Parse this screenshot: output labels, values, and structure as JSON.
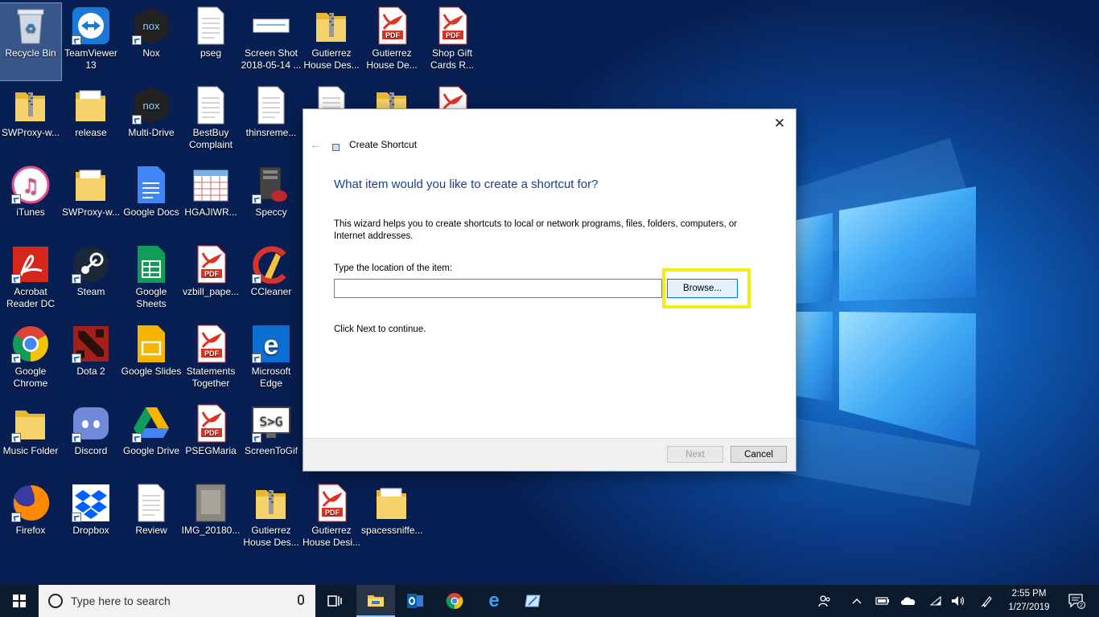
{
  "desktop": {
    "icons": [
      {
        "label": "Recycle Bin",
        "kind": "recycle",
        "shortcut": false,
        "selected": true
      },
      {
        "label": "TeamViewer 13",
        "kind": "teamviewer",
        "shortcut": true
      },
      {
        "label": "Nox",
        "kind": "nox",
        "shortcut": true
      },
      {
        "label": "pseg",
        "kind": "doc",
        "shortcut": false
      },
      {
        "label": "Screen Shot 2018-05-14 ...",
        "kind": "screenshot",
        "shortcut": false
      },
      {
        "label": "Gutierrez House Des...",
        "kind": "zipfolder",
        "shortcut": false
      },
      {
        "label": "Gutierrez House De...",
        "kind": "pdf",
        "shortcut": false
      },
      {
        "label": "Shop Gift Cards R...",
        "kind": "pdf",
        "shortcut": false
      },
      {
        "label": "SWProxy-w...",
        "kind": "zipfolder",
        "shortcut": false
      },
      {
        "label": "release",
        "kind": "folder",
        "shortcut": false
      },
      {
        "label": "Multi-Drive",
        "kind": "nox",
        "shortcut": true
      },
      {
        "label": "BestBuy Complaint",
        "kind": "doc",
        "shortcut": false
      },
      {
        "label": "thinsreme...",
        "kind": "doc",
        "shortcut": false
      },
      {
        "label": "",
        "kind": "doc",
        "shortcut": false
      },
      {
        "label": "",
        "kind": "zipfolder",
        "shortcut": false
      },
      {
        "label": "",
        "kind": "pdf",
        "shortcut": false
      },
      {
        "label": "iTunes",
        "kind": "itunes",
        "shortcut": true
      },
      {
        "label": "SWProxy-w...",
        "kind": "folder",
        "shortcut": false
      },
      {
        "label": "Google Docs",
        "kind": "gdocs",
        "shortcut": false
      },
      {
        "label": "HGAJIWR...",
        "kind": "calendar",
        "shortcut": false
      },
      {
        "label": "Speccy",
        "kind": "speccy",
        "shortcut": true
      },
      {
        "label": "Acrobat Reader DC",
        "kind": "acrobat",
        "shortcut": true
      },
      {
        "label": "Steam",
        "kind": "steam",
        "shortcut": true
      },
      {
        "label": "Google Sheets",
        "kind": "gsheets",
        "shortcut": false
      },
      {
        "label": "vzbill_pape...",
        "kind": "pdf",
        "shortcut": false
      },
      {
        "label": "CCleaner",
        "kind": "ccleaner",
        "shortcut": true
      },
      {
        "label": "Google Chrome",
        "kind": "chrome",
        "shortcut": true
      },
      {
        "label": "Dota 2",
        "kind": "dota",
        "shortcut": true
      },
      {
        "label": "Google Slides",
        "kind": "gslides",
        "shortcut": false
      },
      {
        "label": "Statements Together",
        "kind": "pdf",
        "shortcut": false
      },
      {
        "label": "Microsoft Edge",
        "kind": "edge",
        "shortcut": true
      },
      {
        "label": "Music Folder",
        "kind": "folder-plain",
        "shortcut": true
      },
      {
        "label": "Discord",
        "kind": "discord",
        "shortcut": true
      },
      {
        "label": "Google Drive",
        "kind": "gdrive",
        "shortcut": true
      },
      {
        "label": "PSEGMaria",
        "kind": "pdf",
        "shortcut": false
      },
      {
        "label": "ScreenToGif",
        "kind": "screentogif",
        "shortcut": true
      },
      {
        "label": "Firefox",
        "kind": "firefox",
        "shortcut": true
      },
      {
        "label": "Dropbox",
        "kind": "dropbox",
        "shortcut": true
      },
      {
        "label": "Review",
        "kind": "doc",
        "shortcut": false
      },
      {
        "label": "IMG_20180...",
        "kind": "image",
        "shortcut": false
      },
      {
        "label": "Gutierrez House Des...",
        "kind": "zipfolder",
        "shortcut": false
      },
      {
        "label": "Gutierrez House Desi...",
        "kind": "pdf",
        "shortcut": false
      },
      {
        "label": "spacessniffe...",
        "kind": "folder",
        "shortcut": false
      }
    ]
  },
  "dialog": {
    "close_glyph": "✕",
    "back_glyph": "←",
    "wizard_title": "Create Shortcut",
    "question": "What item would you like to create a shortcut for?",
    "description": "This wizard helps you to create shortcuts to local or network programs, files, folders, computers, or Internet addresses.",
    "location_label": "Type the location of the item:",
    "location_value": "",
    "browse_label": "Browse...",
    "continue_text": "Click Next to continue.",
    "next_label": "Next",
    "cancel_label": "Cancel",
    "highlight_color": "#f5ec11"
  },
  "taskbar": {
    "search_placeholder": "Type here to search",
    "time": "2:55 PM",
    "date": "1/27/2019",
    "notification_count": "2"
  },
  "colors": {
    "accent": "#0078d7",
    "question_text": "#1a3e8a",
    "taskbar_bg": "#0c1a2e"
  }
}
